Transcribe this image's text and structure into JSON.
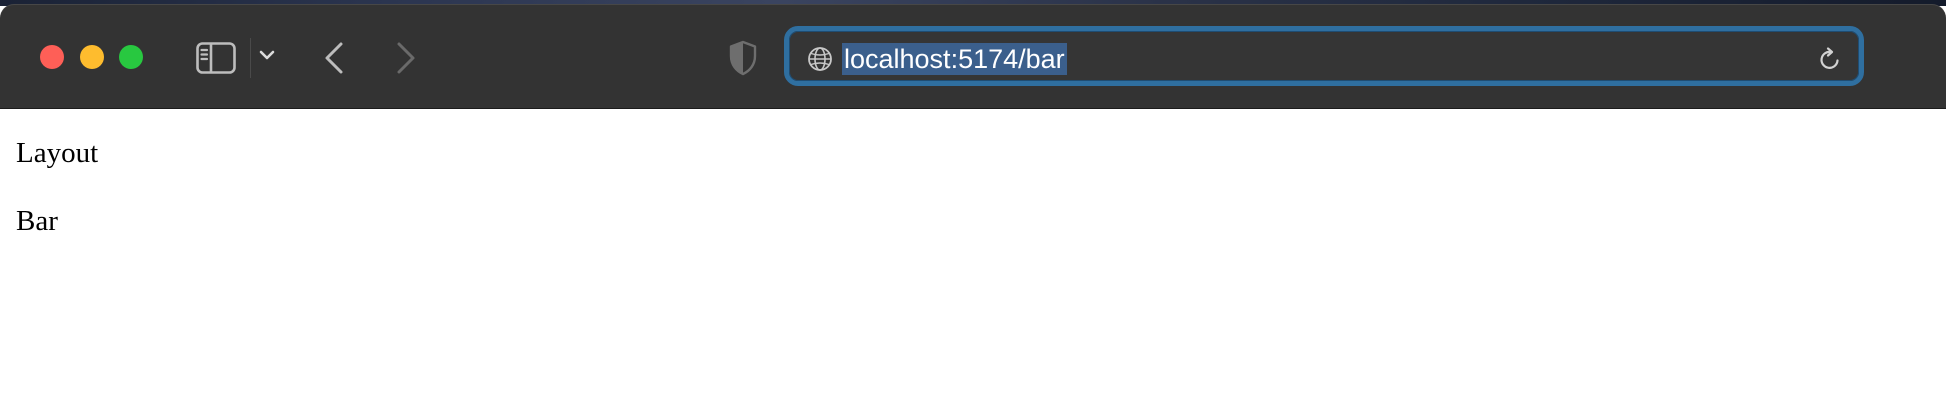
{
  "browser": {
    "address_bar": {
      "url": "localhost:5174/bar"
    },
    "icons": {
      "sidebar_toggle": "sidebar-icon",
      "tab_menu": "chevron-down-icon",
      "back": "chevron-left-icon",
      "forward": "chevron-right-icon",
      "privacy": "shield-icon",
      "site": "globe-icon",
      "reload": "reload-icon"
    },
    "colors": {
      "toolbar": "#333333",
      "focus_ring": "#2f6fa0",
      "url_selection": "#3b5f8c",
      "close": "#fe5f57",
      "minimize": "#febc2e",
      "zoom": "#28c840"
    }
  },
  "page": {
    "lines": [
      "Layout",
      "Bar"
    ]
  }
}
